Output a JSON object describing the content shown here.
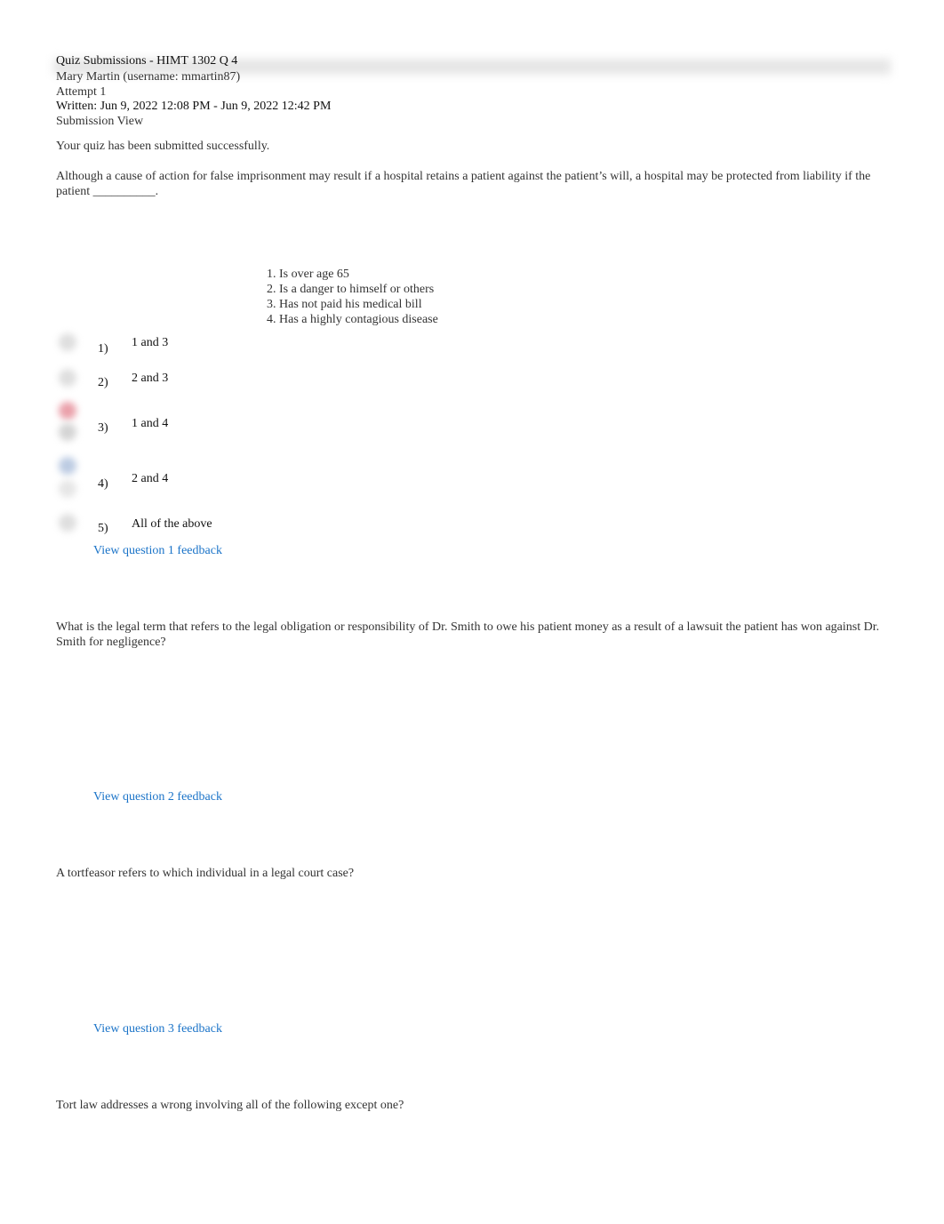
{
  "header": {
    "title": "Quiz Submissions - HIMT 1302 Q 4",
    "user": "Mary Martin (username: mmartin87)",
    "attempt": "Attempt 1",
    "written": "Written: Jun 9, 2022 12:08 PM - Jun 9, 2022 12:42 PM",
    "view": "Submission View"
  },
  "status_message": "Your quiz has been submitted successfully.",
  "questions": [
    {
      "text": "Although a cause of action for false imprisonment may result if a hospital retains a patient against the patient’s will, a hospital may be protected from liability if the patient __________.",
      "statements": [
        "Is over age 65",
        "Is a danger to himself or others",
        "Has not paid his medical bill",
        "Has a highly contagious disease"
      ],
      "options": [
        {
          "num": "1)",
          "label": "1 and 3"
        },
        {
          "num": "2)",
          "label": "2 and 3"
        },
        {
          "num": "3)",
          "label": "1 and 4"
        },
        {
          "num": "4)",
          "label": "2 and 4"
        },
        {
          "num": "5)",
          "label": "All of the above"
        }
      ],
      "feedback_link": "View question 1 feedback"
    },
    {
      "text": "What is the legal term that refers to the legal obligation or responsibility of Dr. Smith to owe his patient money as a result of a lawsuit the patient has won against Dr. Smith for negligence?",
      "feedback_link": "View question 2 feedback"
    },
    {
      "text": "A tortfeasor refers to which individual in a legal court case?",
      "feedback_link": "View question 3 feedback"
    },
    {
      "text": "Tort law addresses a wrong involving all of the following except one?"
    }
  ],
  "colors": {
    "link": "#1a73c8",
    "incorrect_marker": "#e8a0a8",
    "selected_marker": "#b8c8e0",
    "neutral_marker": "#dcdcdc"
  }
}
